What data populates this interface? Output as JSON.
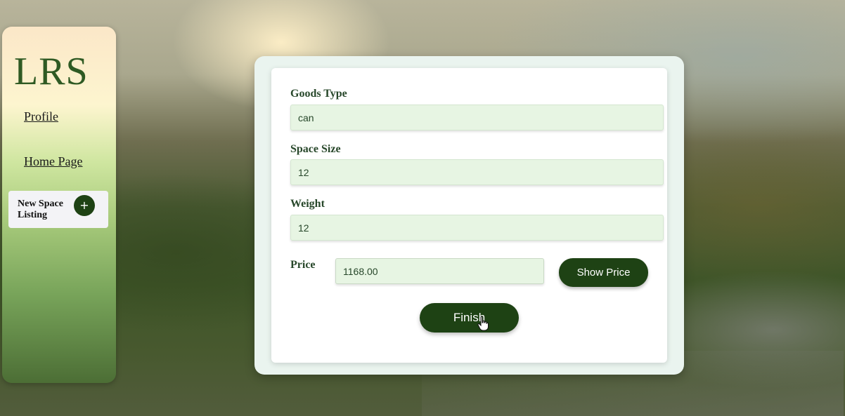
{
  "sidebar": {
    "logo": "LRS",
    "nav": {
      "profile": "Profile",
      "home": "Home Page"
    },
    "new_listing": {
      "label_line1": "New Space",
      "label_line2": "Listing",
      "plus": "+"
    }
  },
  "form": {
    "goods_type": {
      "label": "Goods Type",
      "value": "can"
    },
    "space_size": {
      "label": "Space Size",
      "value": "12"
    },
    "weight": {
      "label": "Weight",
      "value": "12"
    },
    "price": {
      "label": "Price",
      "value": "1168.00"
    },
    "show_price_label": "Show Price",
    "finish_label": "Finish"
  },
  "colors": {
    "brand_dark_green": "#1e4214",
    "input_background": "#e7f5e3",
    "label_green": "#27472a"
  }
}
